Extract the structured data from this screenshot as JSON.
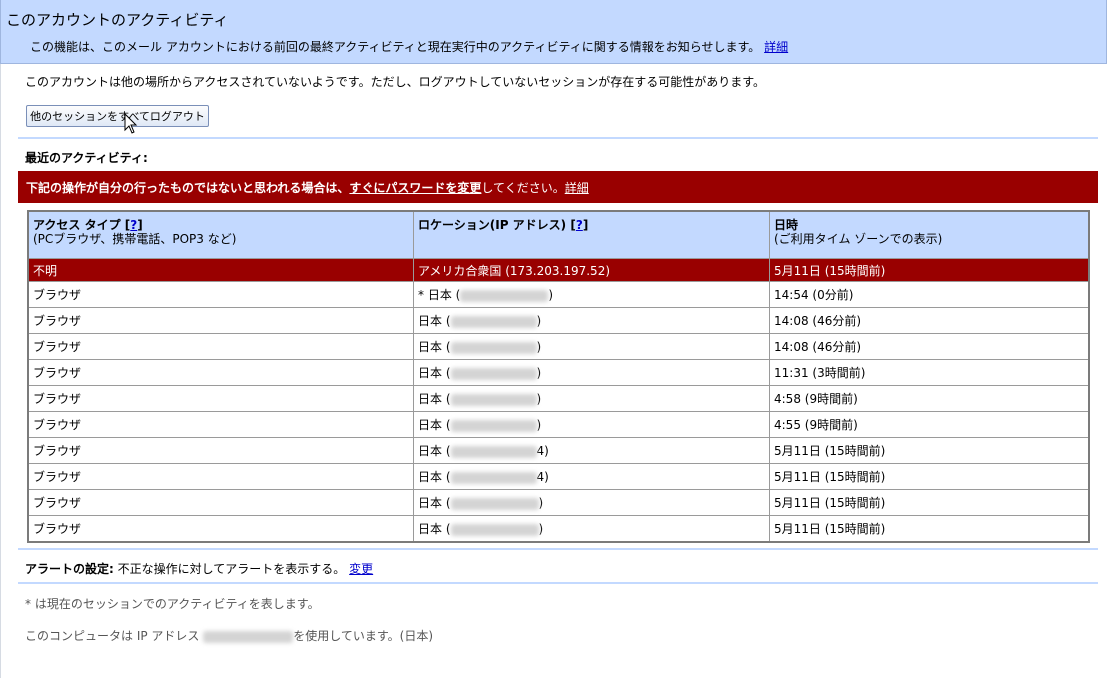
{
  "header": {
    "title": "このアカウントのアクティビティ",
    "description": "この機能は、このメール アカウントにおける前回の最終アクティビティと現在実行中のアクティビティに関する情報をお知らせします。",
    "details_link": "詳細"
  },
  "notice": "このアカウントは他の場所からアクセスされていないようです。ただし、ログアウトしていないセッションが存在する可能性があります。",
  "logout_button": "他のセッションをすべてログアウト",
  "recent_label": "最近のアクティビティ:",
  "warning": {
    "text_before": "下記の操作が自分の行ったものではないと思われる場合は、",
    "change_password_link": "すぐにパスワードを変更",
    "text_after": "してください。",
    "details_link": "詳細"
  },
  "table": {
    "headers": {
      "access_type": "アクセス タイプ",
      "access_help": "?",
      "access_sub": "(PCブラウザ、携帯電話、POP3 など)",
      "location": "ロケーション(IP アドレス)",
      "location_help": "?",
      "datetime": "日時",
      "datetime_sub": "(ご利用タイム ゾーンでの表示)"
    },
    "rows": [
      {
        "access": "不明",
        "location": "アメリカ合衆国 (173.203.197.52)",
        "time": "5月11日 (15時間前)",
        "alert": true
      },
      {
        "access": "ブラウザ",
        "location_prefix": "* 日本 (",
        "location_suffix": ")",
        "time": "14:54 (0分前)"
      },
      {
        "access": "ブラウザ",
        "location_prefix": "日本 (",
        "location_suffix": ")",
        "time": "14:08 (46分前)"
      },
      {
        "access": "ブラウザ",
        "location_prefix": "日本 (",
        "location_suffix": ")",
        "time": "14:08 (46分前)"
      },
      {
        "access": "ブラウザ",
        "location_prefix": "日本 (",
        "location_suffix": ")",
        "time": "11:31 (3時間前)"
      },
      {
        "access": "ブラウザ",
        "location_prefix": "日本 (",
        "location_suffix": ")",
        "time": "4:58 (9時間前)"
      },
      {
        "access": "ブラウザ",
        "location_prefix": "日本 (",
        "location_suffix": ")",
        "time": "4:55 (9時間前)"
      },
      {
        "access": "ブラウザ",
        "location_prefix": "日本 (",
        "location_suffix": "4)",
        "time": "5月11日 (15時間前)"
      },
      {
        "access": "ブラウザ",
        "location_prefix": "日本 (",
        "location_suffix": "4)",
        "time": "5月11日 (15時間前)"
      },
      {
        "access": "ブラウザ",
        "location_prefix": "日本 (",
        "location_suffix": ")",
        "time": "5月11日 (15時間前)"
      },
      {
        "access": "ブラウザ",
        "location_prefix": "日本 (",
        "location_suffix": ")",
        "time": "5月11日 (15時間前)"
      }
    ]
  },
  "alert_setting": {
    "label": "アラートの設定:",
    "text": "不正な操作に対してアラートを表示する。",
    "change_link": "変更"
  },
  "footer": {
    "current_session_note": "* は現在のセッションでのアクティビティを表します。",
    "ip_note_prefix": "このコンピュータは IP アドレス",
    "ip_note_suffix": "を使用しています。(日本)"
  },
  "colors": {
    "header_bg": "#c3d9ff",
    "warning_bg": "#990000",
    "link": "#0000cc"
  }
}
